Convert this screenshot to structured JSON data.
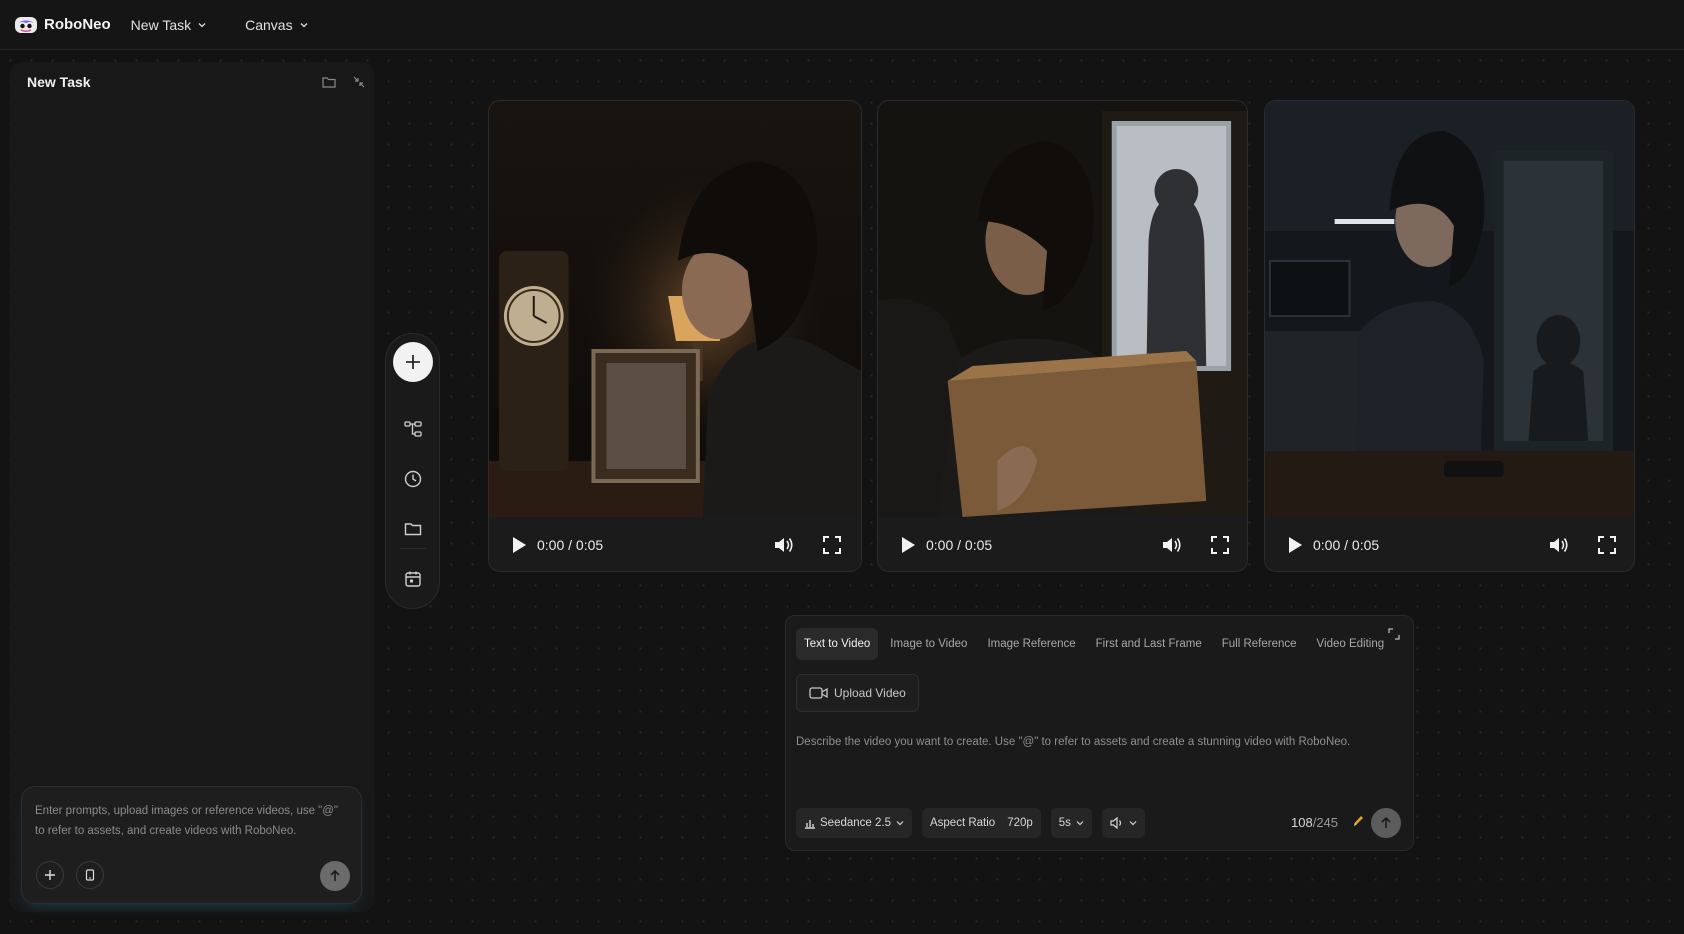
{
  "app": {
    "name": "RoboNeo"
  },
  "topbar": {
    "task_menu_label": "New Task",
    "canvas_menu_label": "Canvas"
  },
  "sidebar": {
    "title": "New Task",
    "icons": [
      "folder-icon",
      "collapse-icon"
    ],
    "prompt_placeholder": "Enter prompts, upload images or reference videos, use \"@\" to refer to assets, and create videos with RoboNeo."
  },
  "toolbar": {
    "items": [
      "add-icon",
      "workflow-icon",
      "history-icon",
      "folder-icon",
      "calendar-icon"
    ]
  },
  "videos": [
    {
      "time": "0:00 / 0:05",
      "progress": 0
    },
    {
      "time": "0:00 / 0:05",
      "progress": 0
    },
    {
      "time": "0:00 / 0:05",
      "progress": 0
    }
  ],
  "generator": {
    "tabs": [
      "Text to Video",
      "Image to Video",
      "Image Reference",
      "First and Last Frame",
      "Full Reference",
      "Video Editing"
    ],
    "active_tab": "Text to Video",
    "upload_label": "Upload Video",
    "placeholder": "Describe the video you want to create. Use \"@\" to refer to assets and create a stunning video with RoboNeo.",
    "model": "Seedance 2.5",
    "aspect_ratio_label": "Aspect Ratio",
    "resolution": "720p",
    "duration": "5s",
    "char_count": "108",
    "char_total": "/245"
  },
  "colors": {
    "background": "#131313",
    "panel": "#181818",
    "accent_pencil": "#e8a020"
  }
}
